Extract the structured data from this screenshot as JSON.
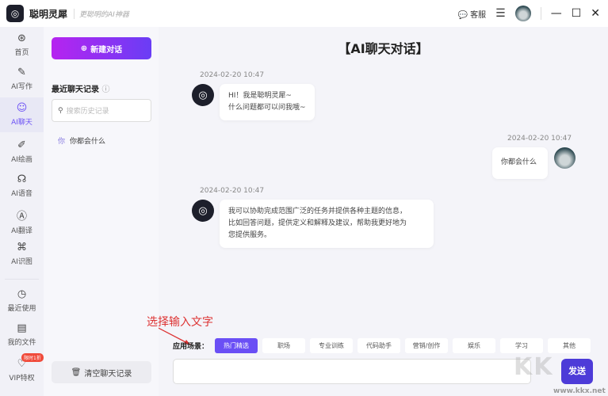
{
  "app": {
    "name": "聪明灵犀",
    "slogan": "更聪明的AI神器",
    "service": "客服"
  },
  "nav": [
    {
      "label": "首页",
      "icon": "⊛"
    },
    {
      "label": "AI写作",
      "icon": "✎"
    },
    {
      "label": "AI聊天",
      "icon": "☺"
    },
    {
      "label": "AI绘画",
      "icon": "✐"
    },
    {
      "label": "AI语音",
      "icon": "☊"
    },
    {
      "label": "AI翻译",
      "icon": "Ⓐ"
    },
    {
      "label": "AI识图",
      "icon": "⌘"
    },
    {
      "label": "最近使用",
      "icon": "◷"
    },
    {
      "label": "我的文件",
      "icon": "▤"
    },
    {
      "label": "VIP特权",
      "icon": "♡",
      "badge": "限时1折"
    }
  ],
  "history": {
    "new_chat": "新建对话",
    "title": "最近聊天记录",
    "search_placeholder": "搜索历史记录",
    "items": [
      {
        "icon": "你",
        "text": "你都会什么"
      }
    ],
    "clear": "清空聊天记录"
  },
  "chat": {
    "title": "【AI聊天对话】",
    "messages": [
      {
        "time": "2024-02-20 10:47",
        "from": "bot",
        "lines": [
          "HI！我是聪明灵犀~",
          "什么问题都可以问我哦~"
        ]
      },
      {
        "time": "2024-02-20 10:47",
        "from": "user",
        "lines": [
          "你都会什么"
        ]
      },
      {
        "time": "2024-02-20 10:47",
        "from": "bot",
        "lines": [
          "我可以协助完成范围广泛的任务并提供各种主题的信息，",
          "比如回答问题，提供定义和解释及建议，帮助我更好地为",
          "您提供服务。"
        ]
      }
    ]
  },
  "annotation": "选择输入文字",
  "scenes": {
    "label": "应用场景：",
    "chips": [
      "热门精选",
      "职场",
      "专业训练",
      "代码助手",
      "营销/创作",
      "娱乐",
      "学习",
      "其他"
    ]
  },
  "send": "发送",
  "watermark": {
    "logo": "KK下载",
    "url": "www.kkx.net"
  }
}
